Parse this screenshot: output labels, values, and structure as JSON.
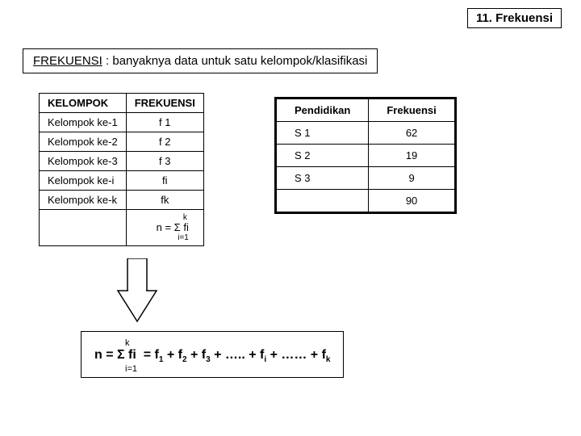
{
  "title": "11. Frekuensi",
  "definition": {
    "term": "FREKUENSI",
    "text": " : banyaknya data untuk satu kelompok/klasifikasi"
  },
  "table_left": {
    "headers": [
      "KELOMPOK",
      "FREKUENSI"
    ],
    "rows": [
      [
        "Kelompok ke-1",
        "f 1"
      ],
      [
        "Kelompok ke-2",
        "f 2"
      ],
      [
        "Kelompok ke-3",
        "f 3"
      ],
      [
        "Kelompok ke-i",
        "fi"
      ],
      [
        "Kelompok ke-k",
        "fk"
      ]
    ],
    "formula_top": "k",
    "formula_mid": "n = Σ fi",
    "formula_bot": "i=1"
  },
  "table_right": {
    "headers": [
      "Pendidikan",
      "Frekuensi"
    ],
    "rows": [
      [
        "S 1",
        "62"
      ],
      [
        "S 2",
        "19"
      ],
      [
        "S 3",
        "9"
      ]
    ],
    "total": "90"
  },
  "equation": {
    "sup": "k",
    "main_prefix": "n = Σ fi  = f",
    "sub": "i=1",
    "full": "n = Σ fi  = f 1 + f 2 + f 3 + ….. + f i + …… + f k"
  },
  "chart_data": {
    "type": "table",
    "title": "Frekuensi per Pendidikan",
    "categories": [
      "S 1",
      "S 2",
      "S 3"
    ],
    "values": [
      62,
      19,
      9
    ],
    "total": 90
  }
}
